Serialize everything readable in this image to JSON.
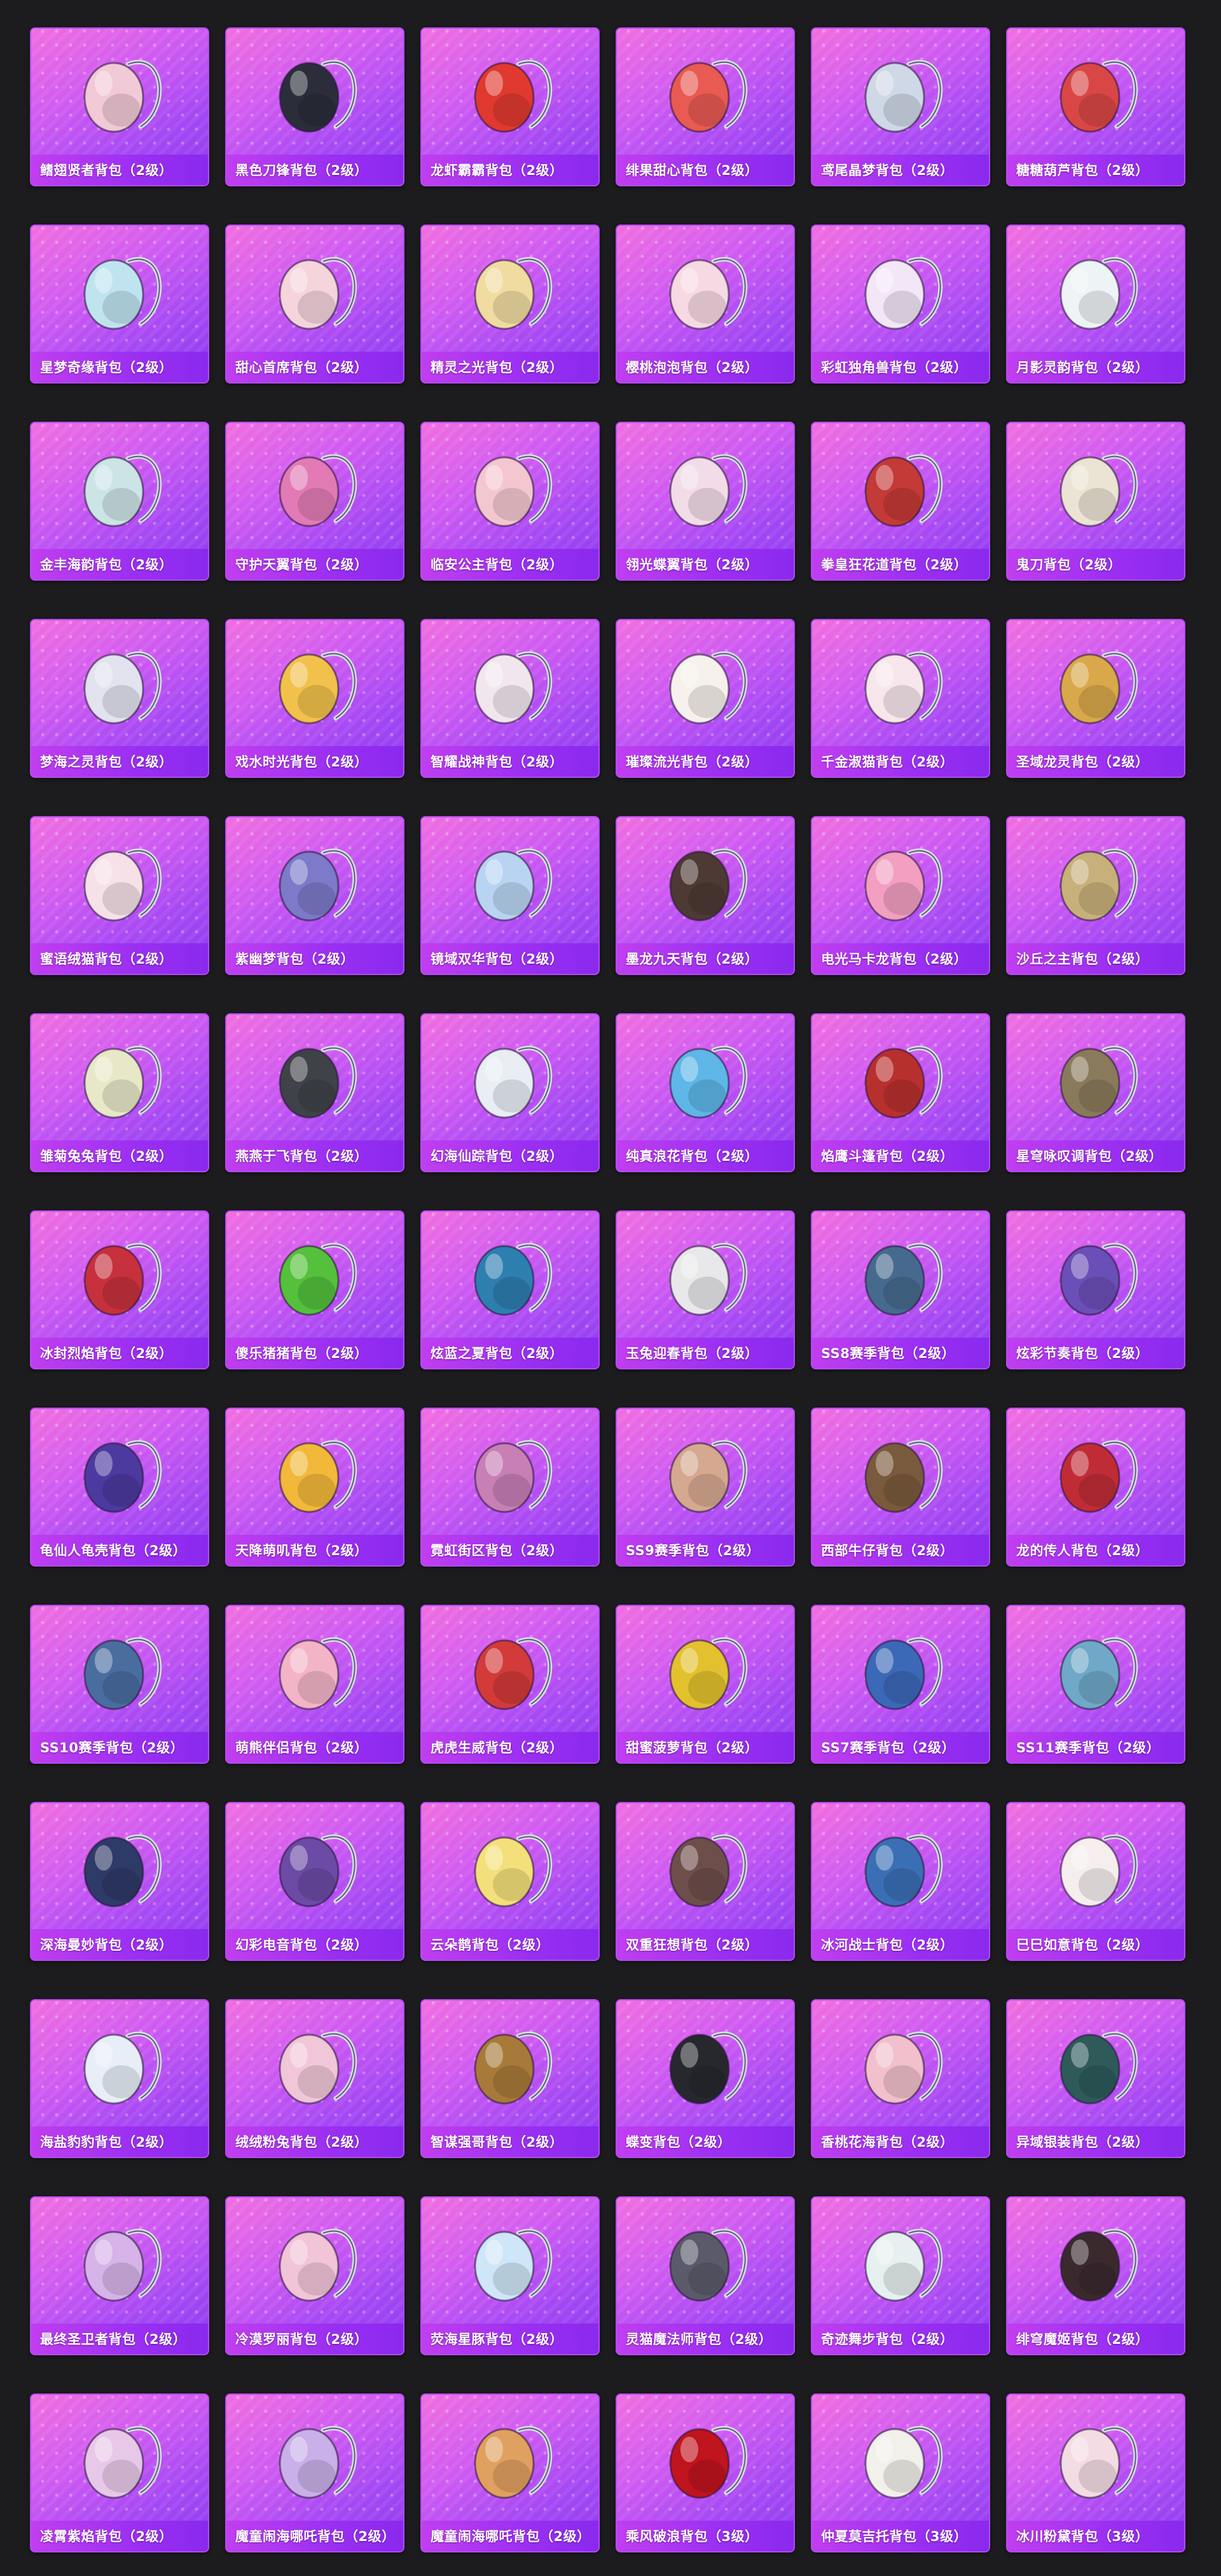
{
  "page": {
    "background": "#1c1c1e",
    "card_gradient": [
      "#f16ee0",
      "#a548f4"
    ],
    "label_bar": "#9a2ff2"
  },
  "items": [
    {
      "label": "鳍翅贤者背包（2级）",
      "color": "#f2c9d6",
      "icon": "fish-backpack-icon"
    },
    {
      "label": "黑色刀锋背包（2级）",
      "color": "#2b2e3a",
      "icon": "tech-backpack-icon"
    },
    {
      "label": "龙虾霸霸背包（2级）",
      "color": "#e0392f",
      "icon": "lobster-backpack-icon"
    },
    {
      "label": "绯果甜心背包（2级）",
      "color": "#e85a52",
      "icon": "fruit-backpack-icon"
    },
    {
      "label": "鸢尾晶梦背包（2级）",
      "color": "#cfd8e6",
      "icon": "crystal-backpack-icon"
    },
    {
      "label": "糖糖葫芦背包（2级）",
      "color": "#d94646",
      "icon": "gourd-backpack-icon"
    },
    {
      "label": "星梦奇缘背包（2级）",
      "color": "#bfe4f0",
      "icon": "swan-backpack-icon"
    },
    {
      "label": "甜心首席背包（2级）",
      "color": "#f5d4dc",
      "icon": "cube-backpack-icon"
    },
    {
      "label": "精灵之光背包（2级）",
      "color": "#f0dca0",
      "icon": "fairy-backpack-icon"
    },
    {
      "label": "樱桃泡泡背包（2级）",
      "color": "#f7d9e3",
      "icon": "bow-backpack-icon"
    },
    {
      "label": "彩虹独角兽背包（2级）",
      "color": "#f3e6f7",
      "icon": "unicorn-backpack-icon"
    },
    {
      "label": "月影灵韵背包（2级）",
      "color": "#eef3f5",
      "icon": "moon-backpack-icon"
    },
    {
      "label": "金丰海韵背包（2级）",
      "color": "#cde4e6",
      "icon": "gourd-bottle-backpack-icon"
    },
    {
      "label": "守护天翼背包（2级）",
      "color": "#e27bb5",
      "icon": "mecha-backpack-icon"
    },
    {
      "label": "临安公主背包（2级）",
      "color": "#f4c6d0",
      "icon": "flower-backpack-icon"
    },
    {
      "label": "翎光蝶翼背包（2级）",
      "color": "#f2dce8",
      "icon": "heart-backpack-icon"
    },
    {
      "label": "拳皇狂花道背包（2级）",
      "color": "#c33a36",
      "icon": "armor-backpack-icon"
    },
    {
      "label": "鬼刀背包（2级）",
      "color": "#ebe3d4",
      "icon": "mask-backpack-icon"
    },
    {
      "label": "梦海之灵背包（2级）",
      "color": "#e2e3ef",
      "icon": "shell-backpack-icon"
    },
    {
      "label": "戏水时光背包（2级）",
      "color": "#f1c14c",
      "icon": "duck-backpack-icon"
    },
    {
      "label": "智耀战神背包（2级）",
      "color": "#f2e6ee",
      "icon": "wing-backpack-icon"
    },
    {
      "label": "璀璨流光背包（2级）",
      "color": "#f6f1ec",
      "icon": "ribbon-backpack-icon"
    },
    {
      "label": "千金淑猫背包（2级）",
      "color": "#f7e6ec",
      "icon": "cat-backpack-icon"
    },
    {
      "label": "圣域龙灵背包（2级）",
      "color": "#d8a84a",
      "icon": "relic-backpack-icon"
    },
    {
      "label": "蜜语绒猫背包（2级）",
      "color": "#f6e1e9",
      "icon": "kitty-backpack-icon"
    },
    {
      "label": "紫幽梦背包（2级）",
      "color": "#7c7ac9",
      "icon": "orb-backpack-icon"
    },
    {
      "label": "镜域双华背包（2级）",
      "color": "#b9d4f2",
      "icon": "mirror-heart-backpack-icon"
    },
    {
      "label": "墨龙九天背包（2级）",
      "color": "#4d3a34",
      "icon": "dragon-medal-backpack-icon"
    },
    {
      "label": "电光马卡龙背包（2级）",
      "color": "#f29fc2",
      "icon": "macaron-backpack-icon"
    },
    {
      "label": "沙丘之主背包（2级）",
      "color": "#c8b07a",
      "icon": "dune-backpack-icon"
    },
    {
      "label": "雏菊兔兔背包（2级）",
      "color": "#e8e8c8",
      "icon": "bunny-backpack-icon"
    },
    {
      "label": "燕燕于飞背包（2级）",
      "color": "#3f4248",
      "icon": "swallow-backpack-icon"
    },
    {
      "label": "幻海仙踪背包（2级）",
      "color": "#e8eef4",
      "icon": "pearl-backpack-icon"
    },
    {
      "label": "纯真浪花背包（2级）",
      "color": "#5fb6e8",
      "icon": "drink-backpack-icon"
    },
    {
      "label": "焰鹰斗篷背包（2级）",
      "color": "#b8302e",
      "icon": "cloak-backpack-icon"
    },
    {
      "label": "星穹咏叹调背包（2级）",
      "color": "#8a7a5c",
      "icon": "cage-backpack-icon"
    },
    {
      "label": "冰封烈焰背包（2级）",
      "color": "#c7303d",
      "icon": "flame-backpack-icon"
    },
    {
      "label": "傻乐猪猪背包（2级）",
      "color": "#54c03b",
      "icon": "pig-backpack-icon"
    },
    {
      "label": "炫蓝之夏背包（2级）",
      "color": "#2d7fb0",
      "icon": "armor-pack-icon"
    },
    {
      "label": "玉兔迎春背包（2级）",
      "color": "#e8e8ea",
      "icon": "rabbit-pack-icon"
    },
    {
      "label": "SS8赛季背包（2级）",
      "color": "#466a8e",
      "icon": "season-pack-icon"
    },
    {
      "label": "炫彩节奏背包（2级）",
      "color": "#6a4fb8",
      "icon": "rhythm-pack-icon"
    },
    {
      "label": "龟仙人龟壳背包（2级）",
      "color": "#4c3aa0",
      "icon": "turtle-shell-icon"
    },
    {
      "label": "天降萌叽背包（2级）",
      "color": "#f2b83a",
      "icon": "chick-pack-icon"
    },
    {
      "label": "霓虹街区背包（2级）",
      "color": "#c77fb6",
      "icon": "neon-pack-icon"
    },
    {
      "label": "SS9赛季背包（2级）",
      "color": "#d5a890",
      "icon": "season-pack-icon"
    },
    {
      "label": "西部牛仔背包（2级）",
      "color": "#7a5a3c",
      "icon": "cowboy-pack-icon"
    },
    {
      "label": "龙的传人背包（2级）",
      "color": "#c02c36",
      "icon": "dragon-pack-icon"
    },
    {
      "label": "SS10赛季背包（2级）",
      "color": "#4a6da0",
      "icon": "season-pack-icon"
    },
    {
      "label": "萌熊伴侣背包（2级）",
      "color": "#f3b4c8",
      "icon": "teddy-bear-icon"
    },
    {
      "label": "虎虎生威背包（2级）",
      "color": "#d33a3a",
      "icon": "tiger-pack-icon"
    },
    {
      "label": "甜蜜菠萝背包（2级）",
      "color": "#e3c12e",
      "icon": "pineapple-pack-icon"
    },
    {
      "label": "SS7赛季背包（2级）",
      "color": "#3c68b8",
      "icon": "season-pack-icon"
    },
    {
      "label": "SS11赛季背包（2级）",
      "color": "#6fa8c8",
      "icon": "season-pack-icon"
    },
    {
      "label": "深海曼妙背包（2级）",
      "color": "#2e3a68",
      "icon": "capsule-backpack-icon"
    },
    {
      "label": "幻彩电音背包（2级）",
      "color": "#6b4ba6",
      "icon": "alien-backpack-icon"
    },
    {
      "label": "云朵鹊背包（2级）",
      "color": "#f4e07a",
      "icon": "bird-backpack-icon"
    },
    {
      "label": "双重狂想背包（2级）",
      "color": "#6d4e4a",
      "icon": "puppy-backpack-icon"
    },
    {
      "label": "冰河战士背包（2级）",
      "color": "#3b6fb5",
      "icon": "glacier-pack-icon"
    },
    {
      "label": "巳巳如意背包（2级）",
      "color": "#f6eeee",
      "icon": "snake-backpack-icon"
    },
    {
      "label": "海盐豹豹背包（2级）",
      "color": "#e8eef8",
      "icon": "seal-backpack-icon"
    },
    {
      "label": "绒绒粉兔背包（2级）",
      "color": "#f1c6d8",
      "icon": "pink-bunny-icon"
    },
    {
      "label": "智谋强哥背包（2级）",
      "color": "#a87a3a",
      "icon": "bear-head-icon"
    },
    {
      "label": "蝶变背包（2级）",
      "color": "#26282e",
      "icon": "butterfly-backpack-icon"
    },
    {
      "label": "香桃花海背包（2级）",
      "color": "#f2c0cc",
      "icon": "peach-backpack-icon"
    },
    {
      "label": "异域银装背包（2级）",
      "color": "#2e5a5a",
      "icon": "silver-backpack-icon"
    },
    {
      "label": "最终圣卫者背包（2级）",
      "color": "#d6b3e8",
      "icon": "guardian-backpack-icon"
    },
    {
      "label": "冷漠罗丽背包（2级）",
      "color": "#f2c4d8",
      "icon": "doll-backpack-icon"
    },
    {
      "label": "荧海星豚背包（2级）",
      "color": "#cfe6f8",
      "icon": "dolphin-backpack-icon"
    },
    {
      "label": "灵猫魔法师背包（2级）",
      "color": "#5a5a6a",
      "icon": "mage-cat-icon"
    },
    {
      "label": "奇迹舞步背包（2级）",
      "color": "#e6f0f0",
      "icon": "dancer-backpack-icon"
    },
    {
      "label": "绯穹魔姬背包（2级）",
      "color": "#3a2a2e",
      "icon": "witch-backpack-icon"
    },
    {
      "label": "凌霄紫焰背包（2级）",
      "color": "#e8c8e8",
      "icon": "flame-lamp-icon"
    },
    {
      "label": "魔童闹海哪吒背包（2级）",
      "color": "#c9b0e8",
      "icon": "ring-pendant-icon"
    },
    {
      "label": "魔童闹海哪吒背包（2级）",
      "color": "#e0a060",
      "icon": "ring-staff-icon"
    },
    {
      "label": "乘风破浪背包（3级）",
      "color": "#c0141e",
      "icon": "rose-backpack-icon"
    },
    {
      "label": "仲夏莫吉托背包（3级）",
      "color": "#f2f0ea",
      "icon": "mojito-backpack-icon"
    },
    {
      "label": "冰川粉黛背包（3级）",
      "color": "#f4dce4",
      "icon": "glacier-floral-icon"
    }
  ]
}
